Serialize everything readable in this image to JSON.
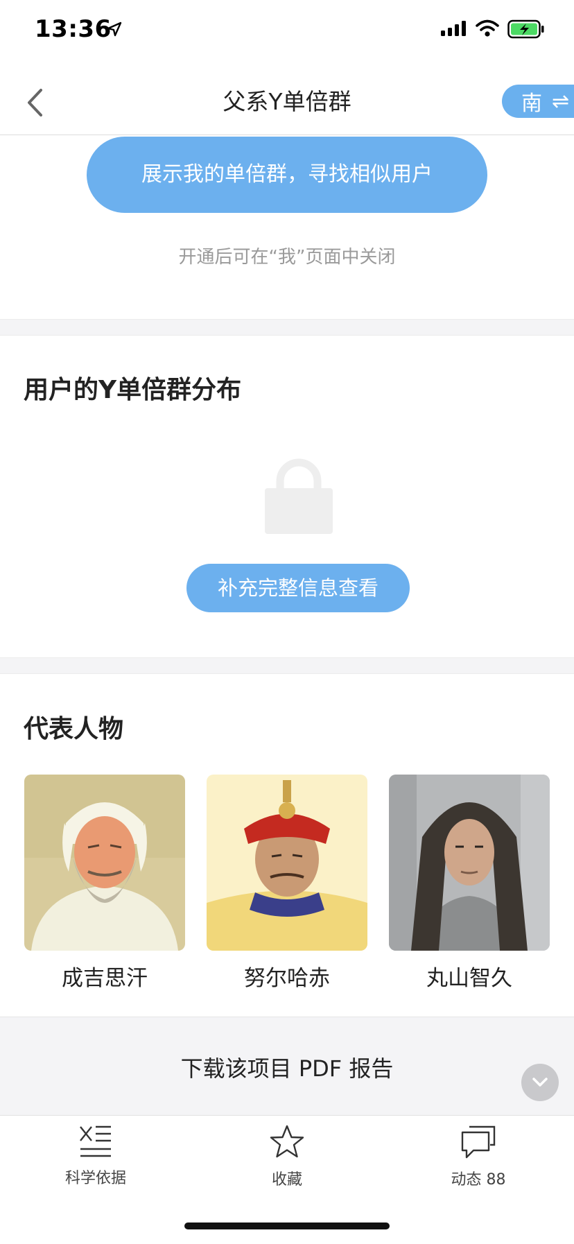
{
  "status_bar": {
    "time": "13:36"
  },
  "nav": {
    "title": "父系Y单倍群",
    "switch_label": "南",
    "switch_symbol": "⇌"
  },
  "share": {
    "button_label": "展示我的单倍群，寻找相似用户",
    "hint": "开通后可在“我”页面中关闭"
  },
  "distribution": {
    "title": "用户的Y单倍群分布",
    "unlock_button": "补充完整信息查看"
  },
  "figures": {
    "title": "代表人物",
    "items": [
      {
        "name": "成吉思汗"
      },
      {
        "name": "努尔哈赤"
      },
      {
        "name": "丸山智久"
      }
    ]
  },
  "pdf": {
    "label": "下载该项目 PDF 报告"
  },
  "tabs": [
    {
      "label": "科学依据",
      "icon": "science-icon"
    },
    {
      "label": "收藏",
      "icon": "star-icon"
    },
    {
      "label": "动态 88",
      "icon": "comment-icon"
    }
  ],
  "colors": {
    "accent": "#6cb0ee",
    "band": "#f4f4f6"
  }
}
